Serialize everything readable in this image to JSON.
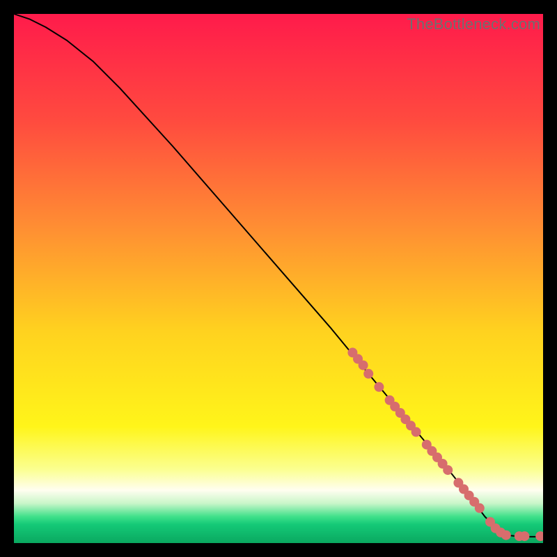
{
  "watermark": "TheBottleneck.com",
  "chart_data": {
    "type": "line",
    "title": "",
    "xlabel": "",
    "ylabel": "",
    "xlim": [
      0,
      100
    ],
    "ylim": [
      0,
      100
    ],
    "grid": false,
    "legend": false,
    "background_gradient": {
      "stops": [
        {
          "pos": 0.0,
          "color": "#ff1b4b"
        },
        {
          "pos": 0.2,
          "color": "#ff4a3f"
        },
        {
          "pos": 0.4,
          "color": "#ff8d33"
        },
        {
          "pos": 0.6,
          "color": "#ffd21f"
        },
        {
          "pos": 0.78,
          "color": "#fff51a"
        },
        {
          "pos": 0.86,
          "color": "#fbff8f"
        },
        {
          "pos": 0.9,
          "color": "#fffef0"
        },
        {
          "pos": 0.925,
          "color": "#c9f6c9"
        },
        {
          "pos": 0.95,
          "color": "#3fe08a"
        },
        {
          "pos": 0.965,
          "color": "#14c977"
        },
        {
          "pos": 1.0,
          "color": "#0aa860"
        }
      ]
    },
    "series": [
      {
        "name": "curve",
        "stroke": "#000000",
        "stroke_width": 2,
        "x": [
          0,
          3,
          6,
          10,
          15,
          20,
          30,
          40,
          50,
          60,
          67,
          72,
          77,
          82,
          86,
          89,
          91,
          93,
          96,
          100
        ],
        "y": [
          100,
          99,
          97.5,
          95,
          91,
          86,
          75,
          63.5,
          52,
          40.5,
          32,
          26,
          20,
          14,
          9,
          5,
          3,
          1.5,
          1.2,
          1.2
        ]
      }
    ],
    "markers": {
      "name": "highlight-points",
      "color": "#d76d6d",
      "radius": 7,
      "points": [
        {
          "x": 64,
          "y": 36
        },
        {
          "x": 65,
          "y": 34.8
        },
        {
          "x": 66,
          "y": 33.6
        },
        {
          "x": 67,
          "y": 32
        },
        {
          "x": 69,
          "y": 29.5
        },
        {
          "x": 71,
          "y": 27
        },
        {
          "x": 72,
          "y": 25.8
        },
        {
          "x": 73,
          "y": 24.6
        },
        {
          "x": 74,
          "y": 23.4
        },
        {
          "x": 75,
          "y": 22.2
        },
        {
          "x": 76,
          "y": 21
        },
        {
          "x": 78,
          "y": 18.6
        },
        {
          "x": 79,
          "y": 17.4
        },
        {
          "x": 80,
          "y": 16.2
        },
        {
          "x": 81,
          "y": 15
        },
        {
          "x": 82,
          "y": 13.8
        },
        {
          "x": 84,
          "y": 11.4
        },
        {
          "x": 85,
          "y": 10.2
        },
        {
          "x": 86,
          "y": 9
        },
        {
          "x": 87,
          "y": 7.8
        },
        {
          "x": 88,
          "y": 6.6
        },
        {
          "x": 90,
          "y": 4
        },
        {
          "x": 91,
          "y": 2.8
        },
        {
          "x": 92,
          "y": 2
        },
        {
          "x": 93,
          "y": 1.5
        },
        {
          "x": 95.5,
          "y": 1.3
        },
        {
          "x": 96.5,
          "y": 1.3
        },
        {
          "x": 99.5,
          "y": 1.3
        }
      ]
    }
  }
}
